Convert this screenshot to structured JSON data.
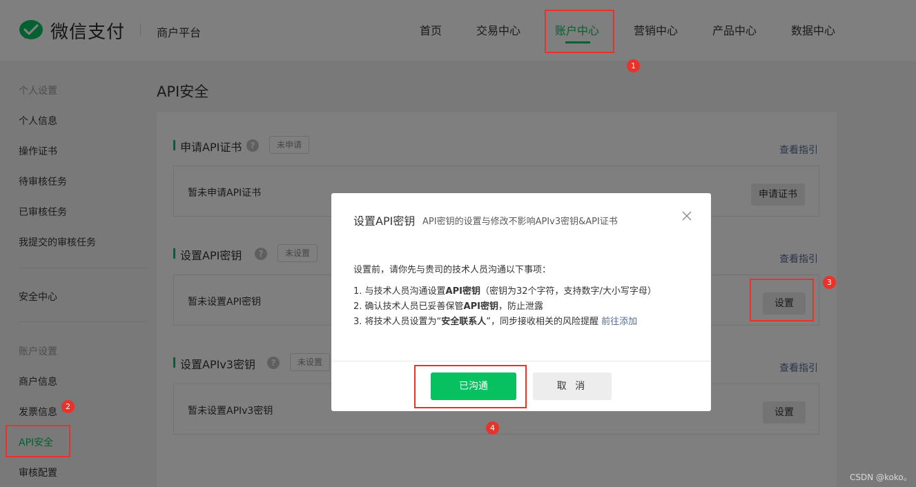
{
  "header": {
    "brand": "微信支付",
    "platform": "商户平台",
    "nav": [
      "首页",
      "交易中心",
      "账户中心",
      "营销中心",
      "产品中心",
      "数据中心"
    ],
    "active_nav": "账户中心"
  },
  "sidebar": {
    "group1": "个人设置",
    "group1_items": [
      "个人信息",
      "操作证书",
      "待审核任务",
      "已审核任务",
      "我提交的审核任务"
    ],
    "security": "安全中心",
    "group2": "账户设置",
    "group2_items": [
      "商户信息",
      "发票信息",
      "API安全",
      "审核配置"
    ],
    "active_item": "API安全"
  },
  "main": {
    "title": "API安全",
    "sections": [
      {
        "title": "申请API证书",
        "tag": "未申请",
        "guide": "查看指引",
        "status": "暂未申请API证书",
        "button": "申请证书"
      },
      {
        "title": "设置API密钥",
        "tag": "未设置",
        "guide": "查看指引",
        "status": "暂未设置API密钥",
        "button": "设置"
      },
      {
        "title": "设置APIv3密钥",
        "tag": "未设置",
        "guide": "查看指引",
        "status": "暂未设置APIv3密钥",
        "button": "设置"
      }
    ]
  },
  "dialog": {
    "title": "设置API密钥",
    "subtitle": "API密钥的设置与修改不影响APIv3密钥&API证书",
    "intro": "设置前，请你先与贵司的技术人员沟通以下事项：",
    "items": [
      {
        "pre": "1. 与技术人员沟通设置",
        "bold": "API密钥",
        "post": "（密钥为32个字符，支持数字/大小写字母）",
        "link": ""
      },
      {
        "pre": "2. 确认技术人员已妥善保管",
        "bold": "API密钥",
        "post": "，防止泄露",
        "link": ""
      },
      {
        "pre": "3. 将技术人员设置为“",
        "bold": "安全联系人",
        "post": "”，同步接收相关的风险提醒 ",
        "link": "前往添加"
      }
    ],
    "confirm": "已沟通",
    "cancel": "取 消"
  },
  "annotations": [
    "1",
    "2",
    "3",
    "4"
  ],
  "watermark": "CSDN @koko。",
  "colors": {
    "brand_green": "#07c160",
    "link_blue": "#576b95",
    "annotation_red": "#e8322c"
  }
}
